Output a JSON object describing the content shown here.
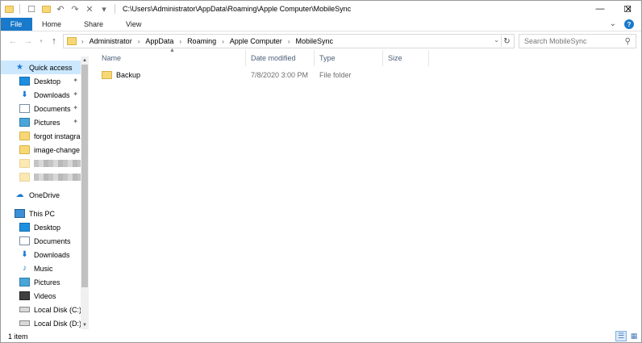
{
  "window": {
    "title_path": "C:\\Users\\Administrator\\AppData\\Roaming\\Apple Computer\\MobileSync"
  },
  "ribbon": {
    "tabs": [
      "File",
      "Home",
      "Share",
      "View"
    ],
    "active_color": "#1979ca"
  },
  "address": {
    "breadcrumbs": [
      "Administrator",
      "AppData",
      "Roaming",
      "Apple Computer",
      "MobileSync"
    ]
  },
  "search": {
    "placeholder": "Search MobileSync"
  },
  "nav": {
    "quick_access": {
      "label": "Quick access",
      "items": [
        {
          "label": "Desktop",
          "icon": "desktop-icon",
          "pinned": true
        },
        {
          "label": "Downloads",
          "icon": "download-icon",
          "pinned": true
        },
        {
          "label": "Documents",
          "icon": "documents-icon",
          "pinned": true
        },
        {
          "label": "Pictures",
          "icon": "pictures-icon",
          "pinned": true
        },
        {
          "label": "forgot instagram",
          "icon": "folder-icon",
          "pinned": false
        },
        {
          "label": "image-change it",
          "icon": "folder-icon",
          "pinned": false
        }
      ]
    },
    "onedrive": {
      "label": "OneDrive"
    },
    "this_pc": {
      "label": "This PC",
      "items": [
        {
          "label": "Desktop",
          "icon": "desktop-icon"
        },
        {
          "label": "Documents",
          "icon": "documents-icon"
        },
        {
          "label": "Downloads",
          "icon": "download-icon"
        },
        {
          "label": "Music",
          "icon": "music-icon"
        },
        {
          "label": "Pictures",
          "icon": "pictures-icon"
        },
        {
          "label": "Videos",
          "icon": "videos-icon"
        },
        {
          "label": "Local Disk (C:)",
          "icon": "disk-icon"
        },
        {
          "label": "Local Disk (D:)",
          "icon": "disk-icon"
        }
      ]
    }
  },
  "columns": {
    "name": "Name",
    "date_modified": "Date modified",
    "type": "Type",
    "size": "Size"
  },
  "files": [
    {
      "name": "Backup",
      "date_modified": "7/8/2020 3:00 PM",
      "type": "File folder",
      "size": ""
    }
  ],
  "status": {
    "item_count": "1 item"
  }
}
